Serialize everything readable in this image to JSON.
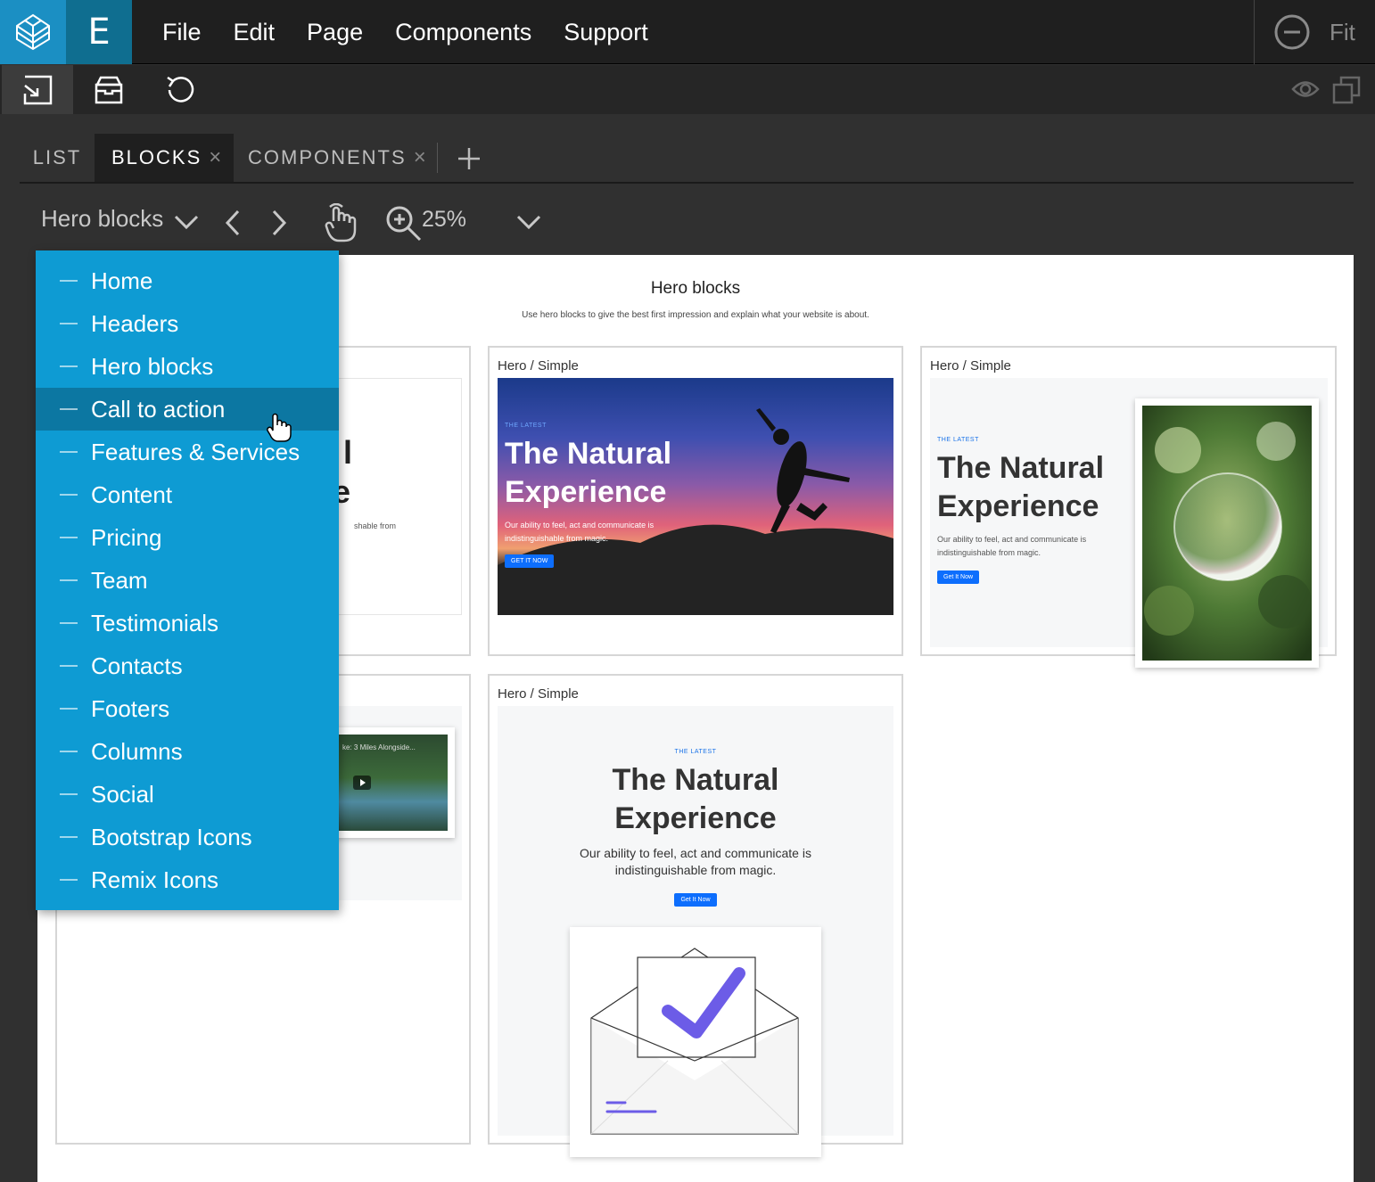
{
  "menubar": {
    "logo_letter": "E",
    "menus": [
      "File",
      "Edit",
      "Page",
      "Components",
      "Support"
    ],
    "fit_label": "Fit"
  },
  "tabs": [
    {
      "label": "LIST",
      "closable": false
    },
    {
      "label": "BLOCKS",
      "closable": true
    },
    {
      "label": "COMPONENTS",
      "closable": true
    }
  ],
  "tab_close_glyph": "×",
  "controls": {
    "category": "Hero blocks",
    "zoom": "25%"
  },
  "canvas": {
    "title": "Hero blocks",
    "subtitle": "Use hero blocks to give the best first impression and explain what your website is about.",
    "cards": [
      {
        "label": "Hero / Simple"
      },
      {
        "label": "Hero / Simple"
      },
      {
        "label": "Hero / Simple"
      }
    ],
    "hero": {
      "eyebrow": "THE LATEST",
      "heading_line1": "The Natural",
      "heading_line2": "Experience",
      "text": "Our ability to feel, act and communicate is indistinguishable from magic.",
      "button_caps": "GET IT NOW",
      "button": "Get It Now"
    },
    "partial_left_text": "shable from",
    "video_title": "ke: 3 Miles Alongside..."
  },
  "dropdown": {
    "items": [
      "Home",
      "Headers",
      "Hero blocks",
      "Call to action",
      "Features & Services",
      "Content",
      "Pricing",
      "Team",
      "Testimonials",
      "Contacts",
      "Footers",
      "Columns",
      "Social",
      "Bootstrap Icons",
      "Remix Icons"
    ],
    "hovered": "Call to action"
  },
  "colors": {
    "menubar": "#1f1f1f",
    "logo_bg": "#1b8fc3",
    "dropdown_bg": "#0e9bd3",
    "dropdown_hover": "#0c77a2",
    "accent_blue": "#0d6efd",
    "check_purple": "#6c5ce7"
  }
}
